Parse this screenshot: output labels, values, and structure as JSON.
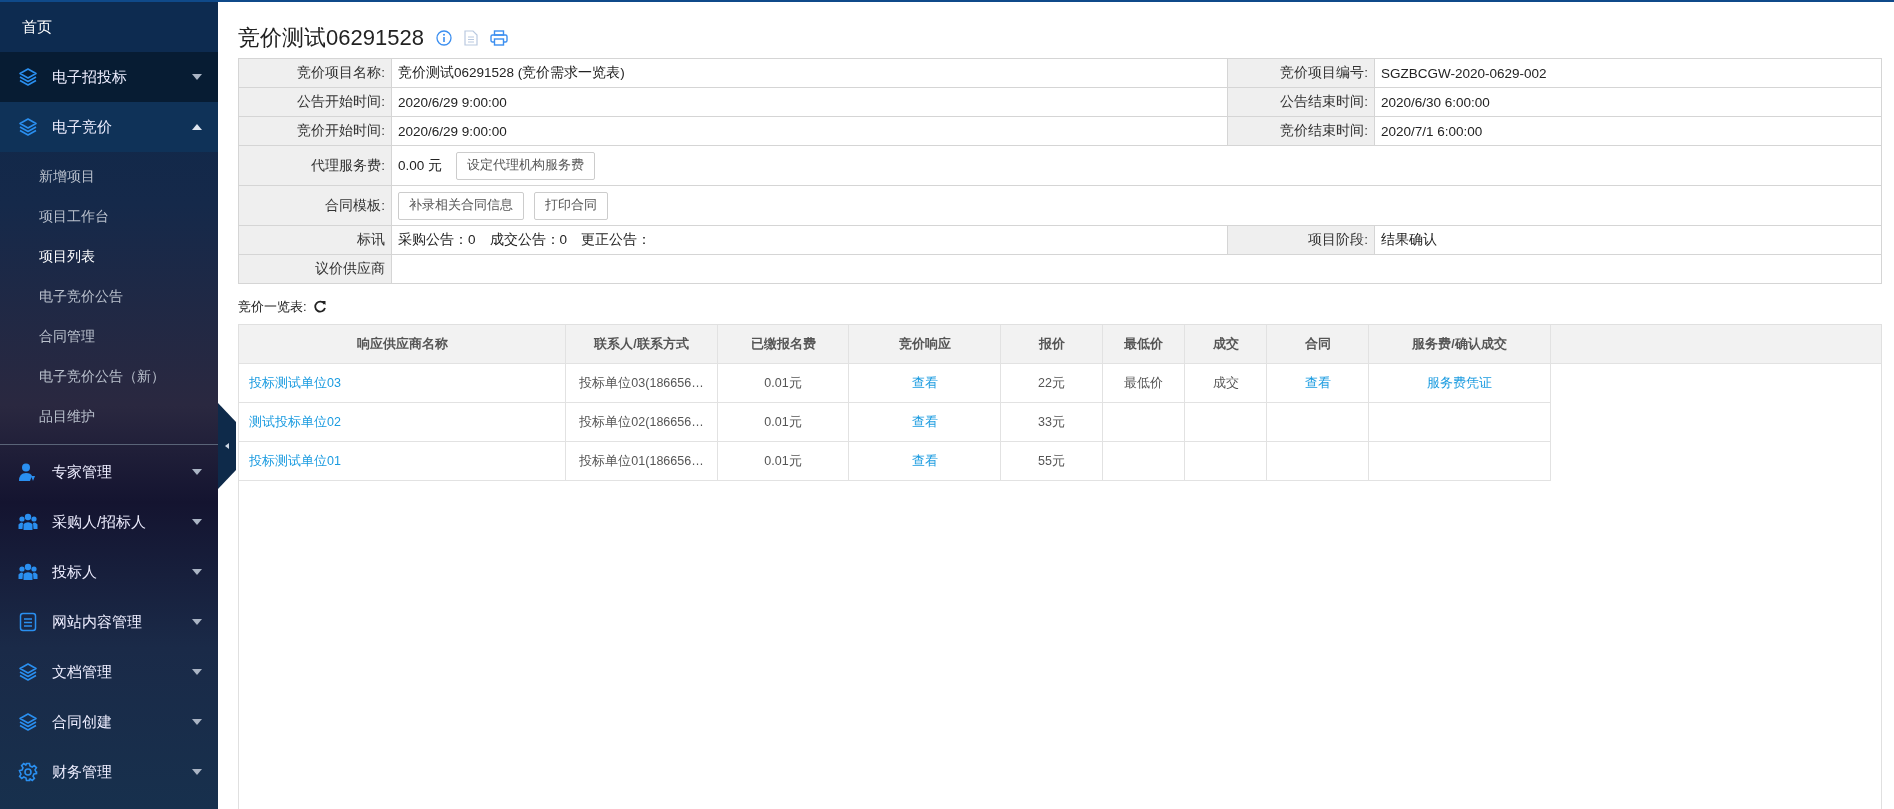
{
  "sidebar": {
    "items": [
      {
        "kind": "home",
        "label": "首页"
      },
      {
        "kind": "menu",
        "label": "电子招投标",
        "expanded": false
      },
      {
        "kind": "menu",
        "label": "电子竞价",
        "expanded": true,
        "children": [
          {
            "label": "新增项目",
            "selected": false
          },
          {
            "label": "项目工作台",
            "selected": false
          },
          {
            "label": "项目列表",
            "selected": true
          },
          {
            "label": "电子竞价公告",
            "selected": false
          },
          {
            "label": "合同管理",
            "selected": false
          },
          {
            "label": "电子竞价公告（新）",
            "selected": false
          },
          {
            "label": "品目维护",
            "selected": false
          }
        ]
      },
      {
        "kind": "menu",
        "label": "专家管理",
        "expanded": false
      },
      {
        "kind": "menu",
        "label": "采购人/招标人",
        "expanded": false
      },
      {
        "kind": "menu",
        "label": "投标人",
        "expanded": false
      },
      {
        "kind": "menu",
        "label": "网站内容管理",
        "expanded": false
      },
      {
        "kind": "menu",
        "label": "文档管理",
        "expanded": false
      },
      {
        "kind": "menu",
        "label": "合同创建",
        "expanded": false
      },
      {
        "kind": "menu",
        "label": "财务管理",
        "expanded": false
      }
    ]
  },
  "page": {
    "title": "竞价测试06291528"
  },
  "info": {
    "rows": [
      {
        "kind": "double",
        "label": "竞价项目名称:",
        "values": [
          "竞价测试06291528 (竞价需求一览表)"
        ],
        "label_2": "竞价项目编号:",
        "value_2": "SGZBCGW-2020-0629-002"
      },
      {
        "kind": "double",
        "label": "公告开始时间:",
        "values": [
          "2020/6/29 9:00:00"
        ],
        "label_2": "公告结束时间:",
        "value_2": "2020/6/30 6:00:00"
      },
      {
        "kind": "double",
        "label": "竞价开始时间:",
        "values": [
          "2020/6/29 9:00:00"
        ],
        "label_2": "竞价结束时间:",
        "value_2": "2020/7/1 6:00:00"
      },
      {
        "kind": "wide",
        "label": "代理服务费:",
        "values": [
          "0.00 元"
        ],
        "buttons": [
          "设定代理机构服务费"
        ]
      },
      {
        "kind": "wide",
        "label": "合同模板:",
        "buttons": [
          "补录相关合同信息",
          "打印合同"
        ]
      },
      {
        "kind": "double",
        "label": "标讯",
        "values": [
          "采购公告：0",
          "成交公告：0",
          "更正公告："
        ],
        "label_2": "项目阶段:",
        "value_2": "结果确认"
      },
      {
        "kind": "wide",
        "label": "议价供应商"
      }
    ]
  },
  "bids": {
    "label": "竞价一览表:",
    "columns": [
      "响应供应商名称",
      "联系人/联系方式",
      "已缴报名费",
      "竞价响应",
      "报价",
      "最低价",
      "成交",
      "合同",
      "服务费/确认成交"
    ],
    "rows": [
      {
        "cells": [
          {
            "kind": "link",
            "text": "投标测试单位03"
          },
          {
            "kind": "text",
            "text": "投标单位03(186656…"
          },
          {
            "kind": "text",
            "text": "0.01元"
          },
          {
            "kind": "link",
            "text": "查看"
          },
          {
            "kind": "text",
            "text": "22元"
          },
          {
            "kind": "text",
            "text": "最低价"
          },
          {
            "kind": "text",
            "text": "成交"
          },
          {
            "kind": "link",
            "text": "查看"
          },
          {
            "kind": "link",
            "text": "服务费凭证"
          }
        ]
      },
      {
        "cells": [
          {
            "kind": "link",
            "text": "测试投标单位02"
          },
          {
            "kind": "text",
            "text": "投标单位02(186656…"
          },
          {
            "kind": "text",
            "text": "0.01元"
          },
          {
            "kind": "link",
            "text": "查看"
          },
          {
            "kind": "text",
            "text": "33元"
          },
          {
            "kind": "empty"
          },
          {
            "kind": "empty"
          },
          {
            "kind": "empty"
          },
          {
            "kind": "empty"
          }
        ]
      },
      {
        "cells": [
          {
            "kind": "link",
            "text": "投标测试单位01"
          },
          {
            "kind": "text",
            "text": "投标单位01(186656…"
          },
          {
            "kind": "text",
            "text": "0.01元"
          },
          {
            "kind": "link",
            "text": "查看"
          },
          {
            "kind": "text",
            "text": "55元"
          },
          {
            "kind": "empty"
          },
          {
            "kind": "empty"
          },
          {
            "kind": "empty"
          },
          {
            "kind": "empty"
          }
        ]
      }
    ]
  }
}
